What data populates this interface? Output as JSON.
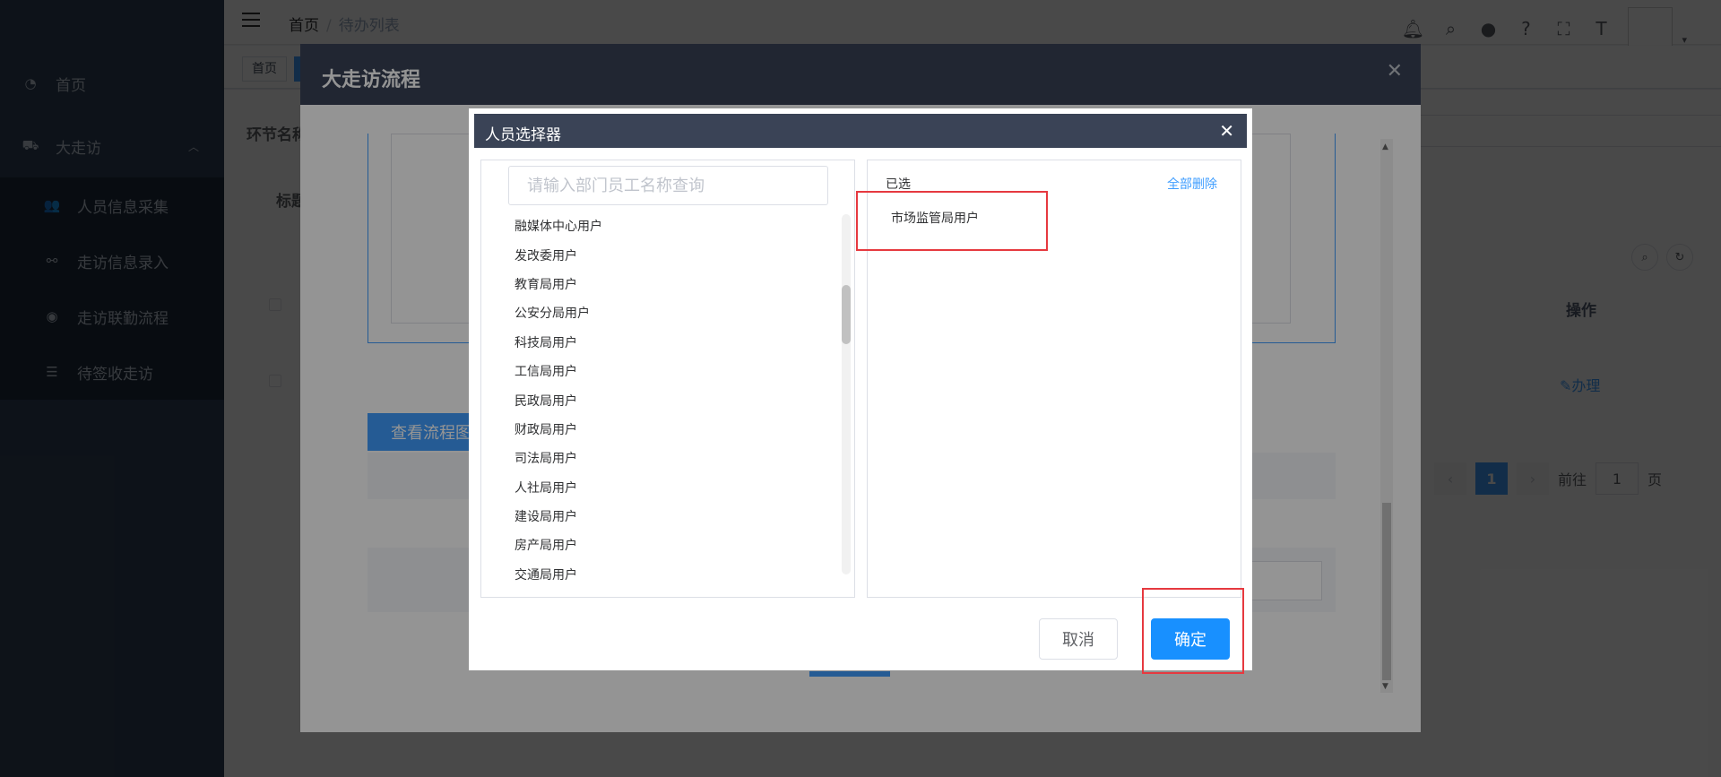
{
  "sidebar": {
    "items": [
      {
        "label": "首页",
        "icon": "dashboard-icon"
      },
      {
        "label": "大走访",
        "icon": "car-icon"
      },
      {
        "label": "人员信息采集",
        "icon": "peoples-icon"
      },
      {
        "label": "走访信息录入",
        "icon": "tree-icon"
      },
      {
        "label": "走访联勤流程",
        "icon": "eye-icon"
      },
      {
        "label": "待签收走访",
        "icon": "list-icon"
      }
    ]
  },
  "navbar": {
    "breadcrumb_home": "首页",
    "breadcrumb_current": "待办列表"
  },
  "tags": {
    "home": "首页"
  },
  "page": {
    "label_node": "环节名称",
    "label_title": "标题",
    "col_action": "操作",
    "action_handle": "办理",
    "pager_current": "1",
    "pager_goto": "前往",
    "pager_goto_value": "1",
    "pager_page": "页"
  },
  "outer_dialog": {
    "title": "大走访流程",
    "view_flow_button": "查看流程图"
  },
  "selector": {
    "title": "人员选择器",
    "search_placeholder": "请输入部门员工名称查询",
    "users": [
      "融媒体中心用户",
      "发改委用户",
      "教育局用户",
      "公安分局用户",
      "科技局用户",
      "工信局用户",
      "民政局用户",
      "财政局用户",
      "司法局用户",
      "人社局用户",
      "建设局用户",
      "房产局用户",
      "交通局用户"
    ],
    "selected_title": "已选",
    "clear_all": "全部删除",
    "selected": [
      "市场监管局用户"
    ],
    "cancel": "取消",
    "confirm": "确定"
  },
  "colors": {
    "primary": "#409eff",
    "confirm": "#1890ff",
    "highlight": "#e6393f",
    "header": "#3a4356"
  }
}
